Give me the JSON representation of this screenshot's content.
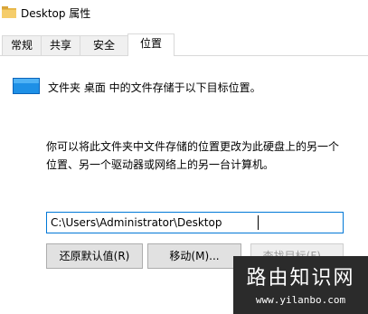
{
  "window": {
    "title": "Desktop 属性"
  },
  "tabs": [
    {
      "label": "常规"
    },
    {
      "label": "共享"
    },
    {
      "label": "安全"
    },
    {
      "label": "位置",
      "active": true
    }
  ],
  "location": {
    "icon": "folder-blue-icon",
    "summary": "文件夹 桌面 中的文件存储于以下目标位置。",
    "description_line1": "你可以将此文件夹中文件存储的位置更改为此硬盘上的另一个",
    "description_line2": "位置、另一个驱动器或网络上的另一台计算机。",
    "path_value": "C:\\Users\\Administrator\\Desktop"
  },
  "buttons": {
    "restore_default": "还原默认值(R)",
    "move": "移动(M)...",
    "find_target": "查找目标(F)..."
  },
  "watermark": {
    "title": "路由知识网",
    "url": "www.yilanbo.com"
  },
  "colors": {
    "accent": "#0078d7",
    "folder_blue": "#1e90e6",
    "watermark_bg": "#2b2b2b"
  }
}
